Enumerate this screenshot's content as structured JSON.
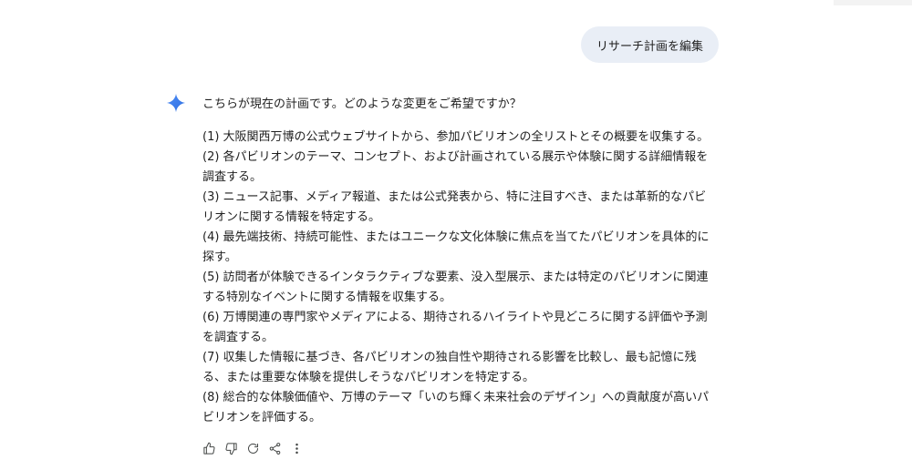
{
  "user_message": {
    "text": "リサーチ計画を編集"
  },
  "assistant": {
    "icon": "gemini-sparkle-icon",
    "accent_color": "#4285f4",
    "intro": "こちらが現在の計画です。どのような変更をご希望ですか？",
    "plan_items": [
      "(1) 大阪関西万博の公式ウェブサイトから、参加パビリオンの全リストとその概要を収集する。",
      "(2) 各パビリオンのテーマ、コンセプト、および計画されている展示や体験に関する詳細情報を調査する。",
      "(3) ニュース記事、メディア報道、または公式発表から、特に注目すべき、または革新的なパビリオンに関する情報を特定する。",
      "(4) 最先端技術、持続可能性、またはユニークな文化体験に焦点を当てたパビリオンを具体的に探す。",
      "(5) 訪問者が体験できるインタラクティブな要素、没入型展示、または特定のパビリオンに関連する特別なイベントに関する情報を収集する。",
      "(6) 万博関連の専門家やメディアによる、期待されるハイライトや見どころに関する評価や予測を調査する。",
      "(7) 収集した情報に基づき、各パビリオンの独自性や期待される影響を比較し、最も記憶に残る、または重要な体験を提供しそうなパビリオンを特定する。",
      "(8) 総合的な体験価値や、万博のテーマ「いのち輝く未来社会のデザイン」への貢献度が高いパビリオンを評価する。"
    ]
  },
  "actions": [
    {
      "icon": "thumbs-up-icon"
    },
    {
      "icon": "thumbs-down-icon"
    },
    {
      "icon": "regenerate-icon"
    },
    {
      "icon": "share-icon"
    },
    {
      "icon": "more-vert-icon"
    }
  ],
  "colors": {
    "user_bubble": "#e9eef6",
    "text": "#1f1f1f",
    "icon": "#444746"
  }
}
